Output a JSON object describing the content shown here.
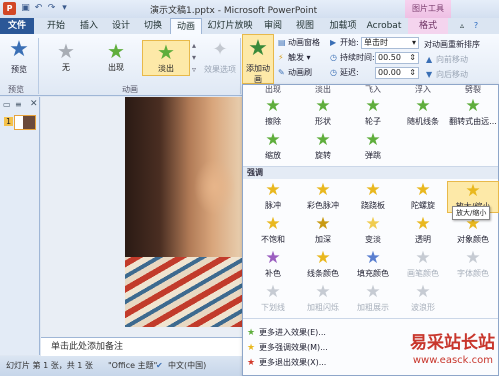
{
  "window": {
    "title": "演示文稿1.pptx - Microsoft PowerPoint",
    "context_tab_group": "图片工具"
  },
  "tabs": [
    {
      "label": "文件"
    },
    {
      "label": "开始"
    },
    {
      "label": "插入"
    },
    {
      "label": "设计"
    },
    {
      "label": "切换"
    },
    {
      "label": "动画"
    },
    {
      "label": "幻灯片放映"
    },
    {
      "label": "审阅"
    },
    {
      "label": "视图"
    },
    {
      "label": "加载项"
    },
    {
      "label": "Acrobat"
    },
    {
      "label": "格式"
    }
  ],
  "ribbon": {
    "preview_label": "预览",
    "preview_group": "预览",
    "effects": [
      {
        "label": "无",
        "icon": "star-gray-icon"
      },
      {
        "label": "出现",
        "icon": "star-green-icon"
      },
      {
        "label": "淡出",
        "icon": "star-green-icon",
        "selected": true
      }
    ],
    "effect_options_label": "效果选项",
    "animation_group": "动画",
    "add_animation_label": "添加动画",
    "animation_pane_label": "动画窗格",
    "trigger_label": "触发",
    "animation_painter_label": "动画刷",
    "start_label": "开始:",
    "start_value": "单击时",
    "duration_label": "持续时间:",
    "duration_value": "00.50",
    "delay_label": "延迟:",
    "delay_value": "00.00",
    "reorder_label": "对动画重新排序",
    "move_earlier_label": "向前移动",
    "move_later_label": "向后移动"
  },
  "slide_pane": {
    "slide_number": "1"
  },
  "notes_placeholder": "单击此处添加备注",
  "statusbar": {
    "slide_info": "幻灯片 第 1 张，共 1 张",
    "theme": "\"Office 主题\"",
    "language": "中文(中国)"
  },
  "gallery": {
    "top_row_partial": [
      "出现",
      "淡出",
      "飞入",
      "浮入",
      "劈裂"
    ],
    "row2": [
      {
        "label": "擦除",
        "icon": "star-green-icon"
      },
      {
        "label": "形状",
        "icon": "star-green-icon"
      },
      {
        "label": "轮子",
        "icon": "star-green-icon"
      },
      {
        "label": "随机线条",
        "icon": "star-green-icon"
      },
      {
        "label": "翻转式由远...",
        "icon": "star-green-icon"
      }
    ],
    "row3": [
      {
        "label": "缩放",
        "icon": "star-green-icon"
      },
      {
        "label": "旋转",
        "icon": "star-green-icon"
      },
      {
        "label": "弹跳",
        "icon": "star-green-icon"
      }
    ],
    "emphasis_header": "强调",
    "emphasis_row1": [
      {
        "label": "脉冲",
        "icon": "star-gold-icon"
      },
      {
        "label": "彩色脉冲",
        "icon": "star-gold-icon"
      },
      {
        "label": "跷跷板",
        "icon": "star-gold-icon"
      },
      {
        "label": "陀螺旋",
        "icon": "star-gold-icon"
      },
      {
        "label": "放大/缩小",
        "icon": "star-gold-icon",
        "selected": true
      }
    ],
    "emphasis_row2": [
      {
        "label": "不饱和",
        "icon": "star-gold-icon"
      },
      {
        "label": "加深",
        "icon": "star-gold-icon"
      },
      {
        "label": "变淡",
        "icon": "star-gold-icon"
      },
      {
        "label": "透明",
        "icon": "star-gold-icon"
      },
      {
        "label": "对象颜色",
        "icon": "star-gold-icon"
      }
    ],
    "emphasis_row3": [
      {
        "label": "补色",
        "icon": "star-gold-icon",
        "disabled": false
      },
      {
        "label": "线条颜色",
        "icon": "star-gold-icon",
        "disabled": false
      },
      {
        "label": "填充颜色",
        "icon": "star-gold-icon",
        "disabled": false
      },
      {
        "label": "画笔颜色",
        "icon": "star-gold-icon",
        "disabled": true
      },
      {
        "label": "字体颜色",
        "icon": "star-gold-icon",
        "disabled": true
      }
    ],
    "emphasis_row4": [
      {
        "label": "下划线",
        "icon": "star-gray-icon",
        "disabled": true
      },
      {
        "label": "加粗闪烁",
        "icon": "star-gray-icon",
        "disabled": true
      },
      {
        "label": "加粗展示",
        "icon": "star-gray-icon",
        "disabled": true
      },
      {
        "label": "波浪形",
        "icon": "star-gray-icon",
        "disabled": true
      }
    ],
    "tooltip": "放大/缩小",
    "links": [
      {
        "label": "更多进入效果(E)...",
        "icon": "star-green-icon"
      },
      {
        "label": "更多强调效果(M)...",
        "icon": "star-gold-icon"
      },
      {
        "label": "更多退出效果(X)...",
        "icon": "star-red-icon"
      }
    ]
  },
  "watermark": {
    "text_cn": "易采站长站",
    "url": "www.easck.com"
  },
  "colors": {
    "file_tab": "#2b5797",
    "entrance_green": "#5fae3c",
    "emphasis_gold": "#e9b81f",
    "exit_red": "#d23a2b",
    "selection": "#fde9a8"
  }
}
